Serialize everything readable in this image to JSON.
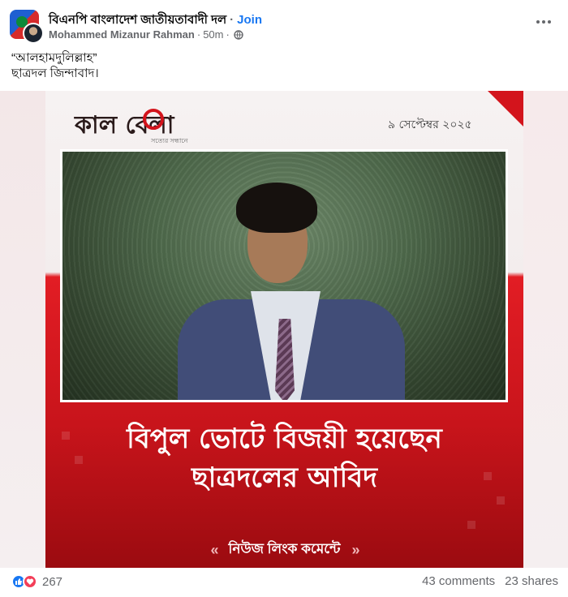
{
  "header": {
    "group_name": "বিএনপি বাংলাদেশ জাতীয়তাবাদী দল",
    "separator": "·",
    "join_label": "Join",
    "author": "Mohammed Mizanur Rahman",
    "time": "50m",
    "privacy_icon": "globe-icon",
    "more_icon": "more-options-icon"
  },
  "post": {
    "line1": "“আলহামদুলিল্লাহ”",
    "line2": "ছাত্রদল জিন্দাবাদ।"
  },
  "image": {
    "logo_text": "কাল বেলা",
    "logo_tagline": "সত্যের সন্ধানে",
    "date": "৯ সেপ্টেম্বর ২০২৫",
    "headline_line1": "বিপুল ভোটে বিজয়ী হয়েছেন",
    "headline_line2": "ছাত্রদলের আবিদ",
    "news_link": "নিউজ লিংক কমেন্টে",
    "accent_color": "#d3141c"
  },
  "footer": {
    "reaction_icons": [
      "like-icon",
      "love-icon"
    ],
    "reaction_count": "267",
    "comments": "43 comments",
    "shares": "23 shares"
  }
}
